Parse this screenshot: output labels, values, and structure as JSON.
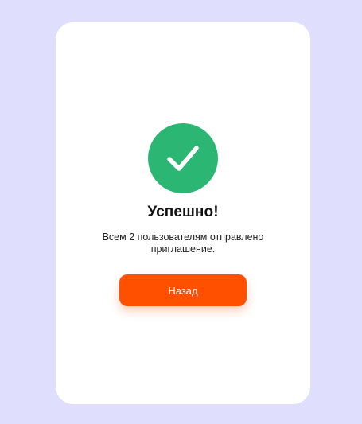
{
  "dialog": {
    "status_icon": "checkmark-icon",
    "title": "Успешно!",
    "message": "Всем 2 пользователям отправлено приглашение.",
    "back_label": "Назад"
  },
  "colors": {
    "page_background": "#dfdffd",
    "card_background": "#ffffff",
    "success": "#2bb673",
    "accent": "#ff5000"
  }
}
